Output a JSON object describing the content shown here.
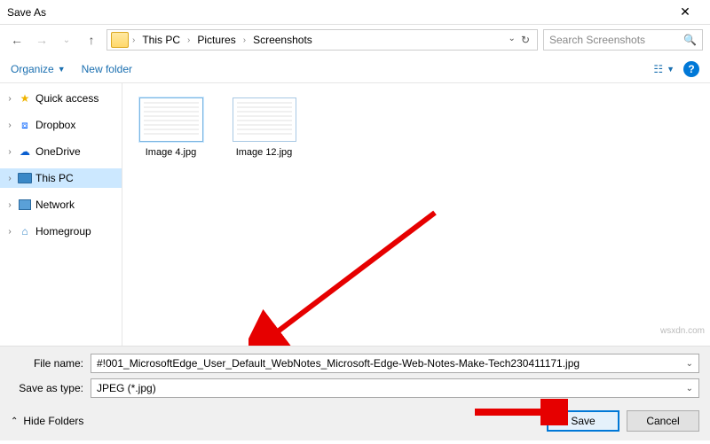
{
  "window": {
    "title": "Save As"
  },
  "nav": {
    "breadcrumb": [
      "This PC",
      "Pictures",
      "Screenshots"
    ],
    "search_placeholder": "Search Screenshots"
  },
  "toolbar": {
    "organize": "Organize",
    "new_folder": "New folder"
  },
  "sidebar": {
    "items": [
      {
        "label": "Quick access",
        "icon": "star",
        "selected": false
      },
      {
        "label": "Dropbox",
        "icon": "box",
        "selected": false
      },
      {
        "label": "OneDrive",
        "icon": "cloud",
        "selected": false
      },
      {
        "label": "This PC",
        "icon": "pc",
        "selected": true
      },
      {
        "label": "Network",
        "icon": "net",
        "selected": false
      },
      {
        "label": "Homegroup",
        "icon": "home",
        "selected": false
      }
    ]
  },
  "files": [
    {
      "label": "Image 4.jpg"
    },
    {
      "label": "Image 12.jpg"
    }
  ],
  "form": {
    "file_name_label": "File name:",
    "file_name_value": "#!001_MicrosoftEdge_User_Default_WebNotes_Microsoft-Edge-Web-Notes-Make-Tech230411171.jpg",
    "save_type_label": "Save as type:",
    "save_type_value": "JPEG (*.jpg)"
  },
  "footer": {
    "hide_folders": "Hide Folders",
    "save": "Save",
    "cancel": "Cancel"
  },
  "watermark": "wsxdn.com"
}
